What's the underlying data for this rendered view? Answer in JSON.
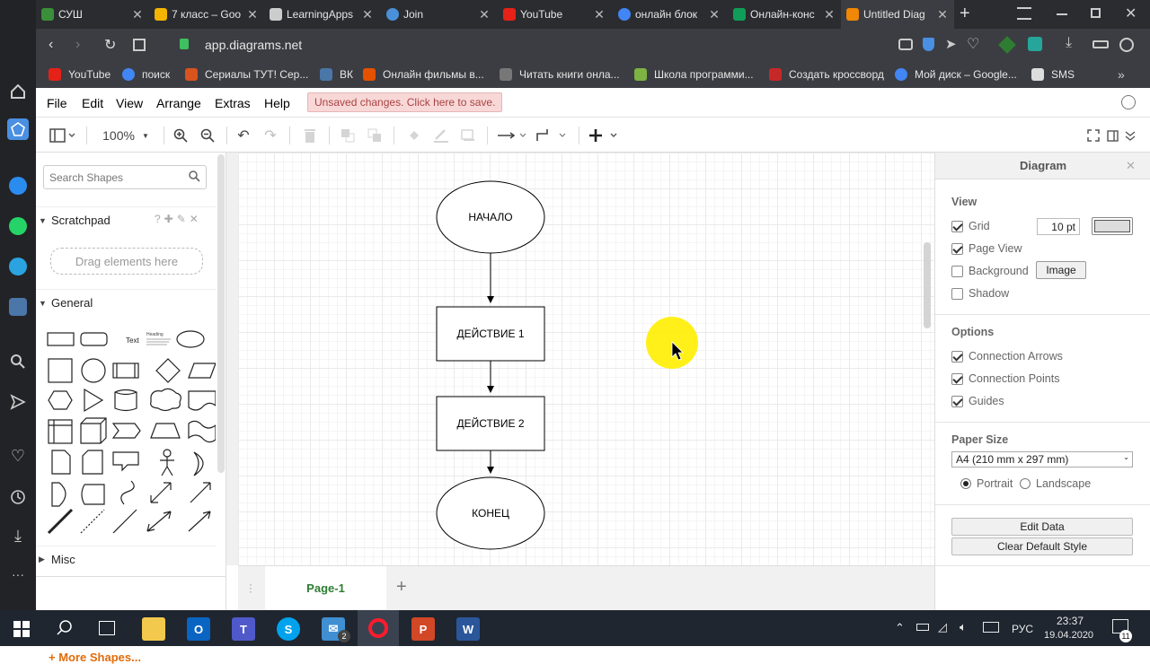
{
  "tabs": [
    {
      "title": "СУШ",
      "color": "#3a8f3a"
    },
    {
      "title": "7 класс – Goo",
      "color": "#f4b400"
    },
    {
      "title": "LearningApps",
      "color": "#cccccc"
    },
    {
      "title": "Join",
      "color": "#4a90d9"
    },
    {
      "title": "YouTube",
      "color": "#e62117"
    },
    {
      "title": "онлайн блок",
      "color": "#4285f4"
    },
    {
      "title": "Онлайн-конс",
      "color": "#0f9d58"
    },
    {
      "title": "Untitled Diag",
      "color": "#f08705"
    }
  ],
  "address": {
    "url": "app.diagrams.net"
  },
  "bookmarks": [
    {
      "label": "YouTube",
      "color": "#e62117"
    },
    {
      "label": "поиск",
      "color": "#4285f4"
    },
    {
      "label": "Сериалы ТУТ! Сер...",
      "color": "#d9531e"
    },
    {
      "label": "ВК",
      "color": "#4a76a8"
    },
    {
      "label": "Онлайн фильмы в...",
      "color": "#e65100"
    },
    {
      "label": "Читать книги онла...",
      "color": "#777777"
    },
    {
      "label": "Школа программи...",
      "color": "#7cb342"
    },
    {
      "label": "Создать кроссворд",
      "color": "#c62828"
    },
    {
      "label": "Мой диск – Google...",
      "color": "#4285f4"
    },
    {
      "label": "SMS",
      "color": "#dddddd"
    }
  ],
  "menu": {
    "file": "File",
    "edit": "Edit",
    "view": "View",
    "arrange": "Arrange",
    "extras": "Extras",
    "help": "Help",
    "unsaved": "Unsaved changes. Click here to save."
  },
  "toolbar": {
    "zoom": "100%"
  },
  "sidebar": {
    "search_placeholder": "Search Shapes",
    "scratchpad": "Scratchpad",
    "scratchpad_hint": "Drag elements here",
    "general": "General",
    "text_shape": "Text",
    "heading_shape": "Heading",
    "misc": "Misc",
    "more_shapes": "More Shapes..."
  },
  "diagram": {
    "start": "НАЧАЛО",
    "action1": "ДЕЙСТВИЕ 1",
    "action2": "ДЕЙСТВИЕ 2",
    "end": "КОНЕЦ"
  },
  "pages": {
    "current": "Page-1"
  },
  "panel": {
    "title": "Diagram",
    "view_heading": "View",
    "grid": {
      "label": "Grid",
      "checked": true,
      "size": "10 pt"
    },
    "page_view": {
      "label": "Page View",
      "checked": true
    },
    "background": {
      "label": "Background",
      "checked": false,
      "button": "Image"
    },
    "shadow": {
      "label": "Shadow",
      "checked": false
    },
    "options_heading": "Options",
    "connection_arrows": {
      "label": "Connection Arrows",
      "checked": true
    },
    "connection_points": {
      "label": "Connection Points",
      "checked": true
    },
    "guides": {
      "label": "Guides",
      "checked": true
    },
    "paper_heading": "Paper Size",
    "paper_size": "A4 (210 mm x 297 mm)",
    "portrait": "Portrait",
    "landscape": "Landscape",
    "orientation": "portrait",
    "edit_data": "Edit Data",
    "clear_style": "Clear Default Style"
  },
  "taskbar": {
    "lang": "РУС",
    "time": "23:37",
    "date": "19.04.2020",
    "notifications": "11",
    "mail_badge": "2"
  },
  "colors": {
    "accent": "#2e7d32",
    "highlight": "#ffee00",
    "more_shapes": "#e26b0a"
  }
}
